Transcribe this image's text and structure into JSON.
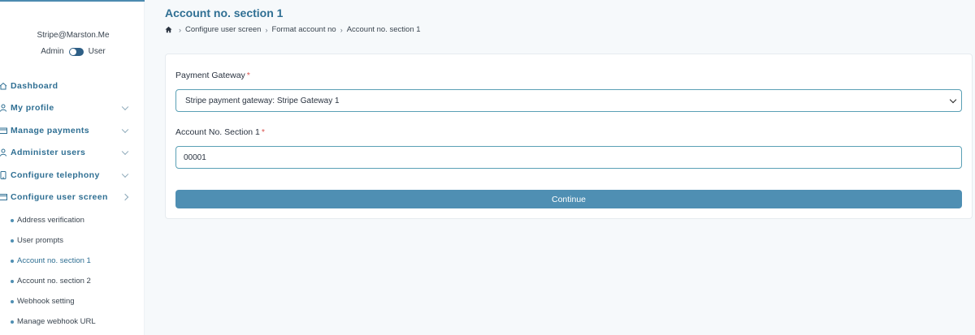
{
  "sidebar": {
    "user_email": "Stripe@Marston.Me",
    "role_left": "Admin",
    "role_right": "User",
    "nav": [
      {
        "label": "Dashboard",
        "icon": "home-outline-icon",
        "has_chevron": false
      },
      {
        "label": "My profile",
        "icon": "user-icon",
        "has_chevron": true
      },
      {
        "label": "Manage payments",
        "icon": "credit-card-icon",
        "has_chevron": true
      },
      {
        "label": "Administer users",
        "icon": "user-icon",
        "has_chevron": true
      },
      {
        "label": "Configure telephony",
        "icon": "phone-icon",
        "has_chevron": true
      },
      {
        "label": "Configure user screen",
        "icon": "screen-icon",
        "has_chevron": true,
        "expanded": true
      }
    ],
    "sub_items": [
      {
        "label": "Address verification"
      },
      {
        "label": "User prompts"
      },
      {
        "label": "Account no. section 1",
        "active": true
      },
      {
        "label": "Account no. section 2"
      },
      {
        "label": "Webhook setting"
      },
      {
        "label": "Manage webhook URL"
      }
    ]
  },
  "page": {
    "title": "Account no. section 1",
    "breadcrumb": [
      "Configure user screen",
      "Format account no",
      "Account no. section 1"
    ]
  },
  "form": {
    "gateway_label": "Payment Gateway",
    "gateway_value": "Stripe payment gateway: Stripe Gateway 1",
    "section_label": "Account No. Section 1",
    "section_value": "00001",
    "required_mark": "*",
    "continue_label": "Continue"
  },
  "colors": {
    "accent": "#2f6f93",
    "button": "#4f8fb3",
    "input_border": "#5aa0b5",
    "required": "#d9534f"
  }
}
